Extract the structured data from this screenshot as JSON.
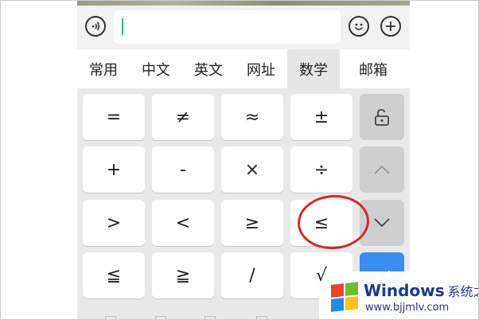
{
  "accent_colors": {
    "caret": "#2fb58d",
    "enter_key": "#3a8ef0",
    "highlight_circle": "#d32b2b",
    "watermark_text": "#1d3a8a"
  },
  "toolbar": {
    "voice_icon": "voice-input-icon",
    "emoji_icon": "emoji-icon",
    "plus_icon": "plus-icon",
    "input_value": ""
  },
  "tabs": [
    {
      "label": "常用",
      "active": false
    },
    {
      "label": "中文",
      "active": false
    },
    {
      "label": "英文",
      "active": false
    },
    {
      "label": "网址",
      "active": false
    },
    {
      "label": "数学",
      "active": true
    },
    {
      "label": "邮箱",
      "active": false
    }
  ],
  "symbol_keys": [
    [
      "=",
      "≠",
      "≈",
      "±"
    ],
    [
      "+",
      "-",
      "×",
      "÷"
    ],
    [
      ">",
      "<",
      "≥",
      "≤"
    ],
    [
      "≦",
      "≧",
      "/",
      "√"
    ]
  ],
  "function_keys": [
    {
      "icon": "unlock-icon"
    },
    {
      "icon": "chevron-up-icon"
    },
    {
      "icon": "chevron-down-icon"
    },
    {
      "icon": "return-icon"
    }
  ],
  "watermark": {
    "title": "Windows",
    "brand": "系统之家",
    "url": "www.bjjmlv.com"
  }
}
